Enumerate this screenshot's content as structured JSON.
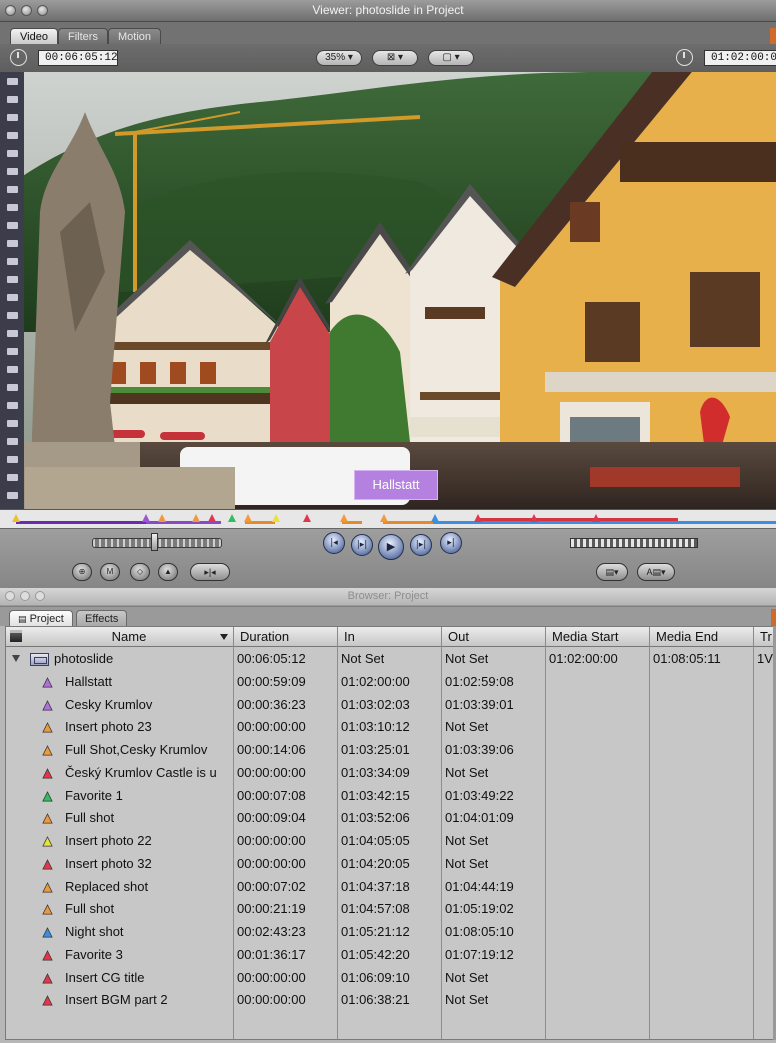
{
  "viewer": {
    "window_title": "Viewer: photoslide in Project",
    "tabs": [
      "Video",
      "Filters",
      "Motion"
    ],
    "timecode_current": "00:06:05:12",
    "timecode_duration": "01:02:00:00",
    "zoom": "35%",
    "view_label": "⊠",
    "overlay_label": "▢",
    "overlay_text": "Hallstatt"
  },
  "transport": {
    "buttons": [
      "In",
      "Out",
      "Play",
      "Next",
      "Out Mark"
    ],
    "sub_buttons": [
      "+",
      "M",
      "◇",
      "▲",
      "▸|◂"
    ],
    "right_buttons": [
      "▤",
      "A▤"
    ]
  },
  "browser": {
    "window_title": "Browser: Project",
    "tabs": [
      "Project",
      "Effects"
    ],
    "columns": [
      "Name",
      "Duration",
      "In",
      "Out",
      "Media Start",
      "Media End",
      "Tr"
    ],
    "sequence": {
      "name": "photoslide",
      "duration": "00:06:05:12",
      "in": "Not Set",
      "out": "Not Set",
      "media_start": "01:02:00:00",
      "media_end": "01:08:05:11",
      "tracks": "1V"
    },
    "rows": [
      {
        "name": "Hallstatt",
        "duration": "00:00:59:09",
        "in": "01:02:00:00",
        "out": "01:02:59:08",
        "color": "#b06ee0"
      },
      {
        "name": "Cesky Krumlov",
        "duration": "00:00:36:23",
        "in": "01:03:02:03",
        "out": "01:03:39:01",
        "color": "#b06ee0"
      },
      {
        "name": "Insert photo 23",
        "duration": "00:00:00:00",
        "in": "01:03:10:12",
        "out": "Not Set",
        "color": "#f0983a"
      },
      {
        "name": "Full Shot,Cesky Krumlov",
        "duration": "00:00:14:06",
        "in": "01:03:25:01",
        "out": "01:03:39:06",
        "color": "#f0983a"
      },
      {
        "name": "Český Krumlov Castle is u",
        "duration": "00:00:00:00",
        "in": "01:03:34:09",
        "out": "Not Set",
        "color": "#e2374a"
      },
      {
        "name": "Favorite 1",
        "duration": "00:00:07:08",
        "in": "01:03:42:15",
        "out": "01:03:49:22",
        "color": "#2fbf5b"
      },
      {
        "name": "Full shot",
        "duration": "00:00:09:04",
        "in": "01:03:52:06",
        "out": "01:04:01:09",
        "color": "#f0983a"
      },
      {
        "name": "Insert photo 22",
        "duration": "00:00:00:00",
        "in": "01:04:05:05",
        "out": "Not Set",
        "color": "#e8e23a"
      },
      {
        "name": "Insert photo 32",
        "duration": "00:00:00:00",
        "in": "01:04:20:05",
        "out": "Not Set",
        "color": "#e2374a"
      },
      {
        "name": "Replaced shot",
        "duration": "00:00:07:02",
        "in": "01:04:37:18",
        "out": "01:04:44:19",
        "color": "#f0983a"
      },
      {
        "name": "Full shot",
        "duration": "00:00:21:19",
        "in": "01:04:57:08",
        "out": "01:05:19:02",
        "color": "#f0983a"
      },
      {
        "name": "Night shot",
        "duration": "00:02:43:23",
        "in": "01:05:21:12",
        "out": "01:08:05:10",
        "color": "#3a8fe0"
      },
      {
        "name": "Favorite 3",
        "duration": "00:01:36:17",
        "in": "01:05:42:20",
        "out": "01:07:19:12",
        "color": "#e2374a"
      },
      {
        "name": "Insert CG title",
        "duration": "00:00:00:00",
        "in": "01:06:09:10",
        "out": "Not Set",
        "color": "#e2374a"
      },
      {
        "name": "Insert BGM part 2",
        "duration": "00:00:00:00",
        "in": "01:06:38:21",
        "out": "Not Set",
        "color": "#e2374a"
      }
    ]
  }
}
